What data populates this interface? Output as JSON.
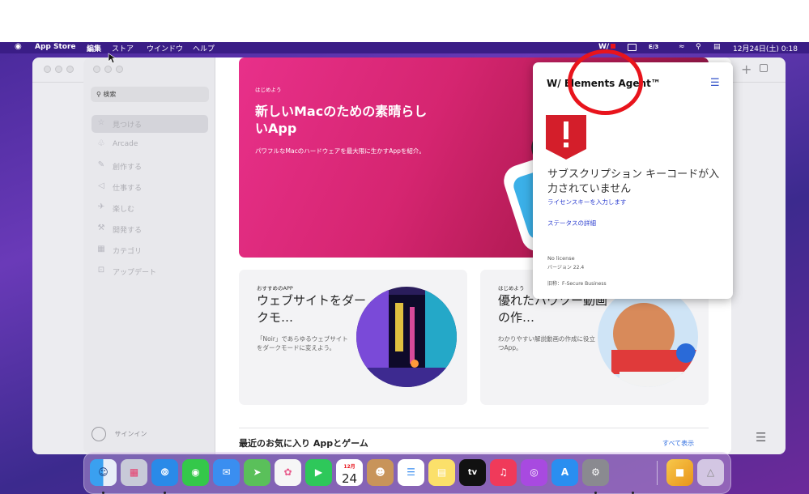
{
  "menubar": {
    "apple": "",
    "app_name": "App Store",
    "menus": [
      "編集",
      "ストア",
      "ウインドウ",
      "ヘルプ"
    ],
    "status_brand": "W/",
    "input_indicator": "E/3",
    "datetime": "12月24日(土) 0:18"
  },
  "sidebar": {
    "search_placeholder": "検索",
    "items": [
      {
        "label": "見つける",
        "icon": "star-icon",
        "glyph": "☆"
      },
      {
        "label": "Arcade",
        "icon": "joystick-icon",
        "glyph": "♧"
      },
      {
        "label": "創作する",
        "icon": "brush-icon",
        "glyph": "✎"
      },
      {
        "label": "仕事する",
        "icon": "paper-plane-icon",
        "glyph": "◁"
      },
      {
        "label": "楽しむ",
        "icon": "rocket-icon",
        "glyph": "✈"
      },
      {
        "label": "開発する",
        "icon": "hammer-icon",
        "glyph": "⚒"
      },
      {
        "label": "カテゴリ",
        "icon": "grid-icon",
        "glyph": "▦"
      },
      {
        "label": "アップデート",
        "icon": "download-icon",
        "glyph": "⊡"
      }
    ],
    "signin": "サインイン"
  },
  "hero": {
    "eyebrow": "はじめよう",
    "title": "新しいMacのための素晴らしいApp",
    "description": "パワフルなMacのハードウェアを最大限に生かすAppを紹介。"
  },
  "cards": [
    {
      "eyebrow": "おすすめのAPP",
      "title": "ウェブサイトをダークモ…",
      "description": "「Noir」であらゆるウェブサイトをダークモードに変えよう。"
    },
    {
      "eyebrow": "はじめよう",
      "title": "優れたハウツー動画の作…",
      "description": "わかりやすい解説動画の作成に役立つApp。"
    }
  ],
  "section": {
    "title": "最近のお気に入り Appとゲーム",
    "see_all": "すべて表示"
  },
  "popup": {
    "brand": "Elements Agent™",
    "logo_mark": "W/",
    "heading": "サブスクリプション キーコードが入力されていません",
    "link_enter_key": "ライセンスキーを入力します",
    "link_status": "ステータスの詳細",
    "license": "No license",
    "version": "バージョン 22.4",
    "old_name": "旧称：F-Secure Business"
  },
  "dock": {
    "calendar_month": "12月",
    "calendar_day": "24",
    "tv_label": "tv"
  },
  "colors": {
    "hero_pink": "#e8308a",
    "link_blue": "#2d3fd0",
    "alert_red": "#d41e2a",
    "annotation_red": "#e8141c",
    "menubar_purple": "#3a1d86"
  }
}
